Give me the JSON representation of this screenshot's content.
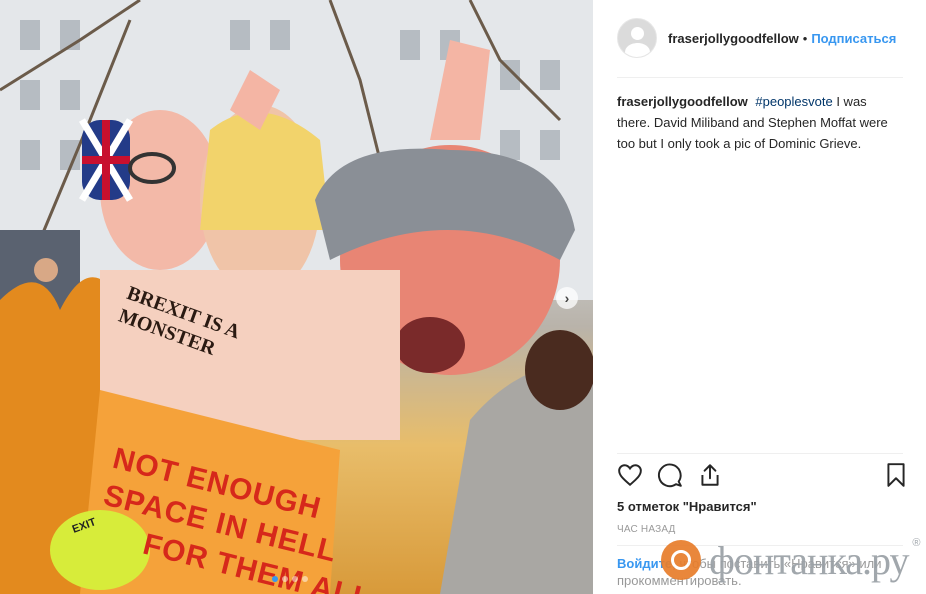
{
  "post": {
    "username": "fraserjollygoodfellow",
    "separator": "•",
    "follow_label": "Подписаться",
    "caption": {
      "username": "fraserjollygoodfellow",
      "hashtag": "#peoplesvote",
      "text": " I was there. David Miliband and Stephen Moffat were too but I only took a pic of Dominic Grieve."
    },
    "likes": "5 отметок \"Нравится\"",
    "time": "ЧАС НАЗАД",
    "login_prompt": {
      "link": "Войдите,",
      "text": " чтобы поставить «Нравится» или прокомментировать."
    },
    "icons": [
      "heart-icon",
      "comment-icon",
      "share-icon",
      "bookmark-icon"
    ]
  },
  "photo": {
    "banner_lines": [
      "NOT ENOUGH",
      "SPACE IN HELL",
      "FOR THEM ALL"
    ],
    "sign_text": [
      "BREXIT IS A",
      "MONSTER"
    ],
    "cap_text": "EXIT",
    "carousel": {
      "total": 4,
      "active": 1
    }
  },
  "watermark": {
    "text": "фонтанка.ру",
    "mark": "®"
  },
  "colors": {
    "accent": "#3897f0",
    "hashtag": "#003569",
    "muted": "#999999",
    "text": "#262626"
  }
}
